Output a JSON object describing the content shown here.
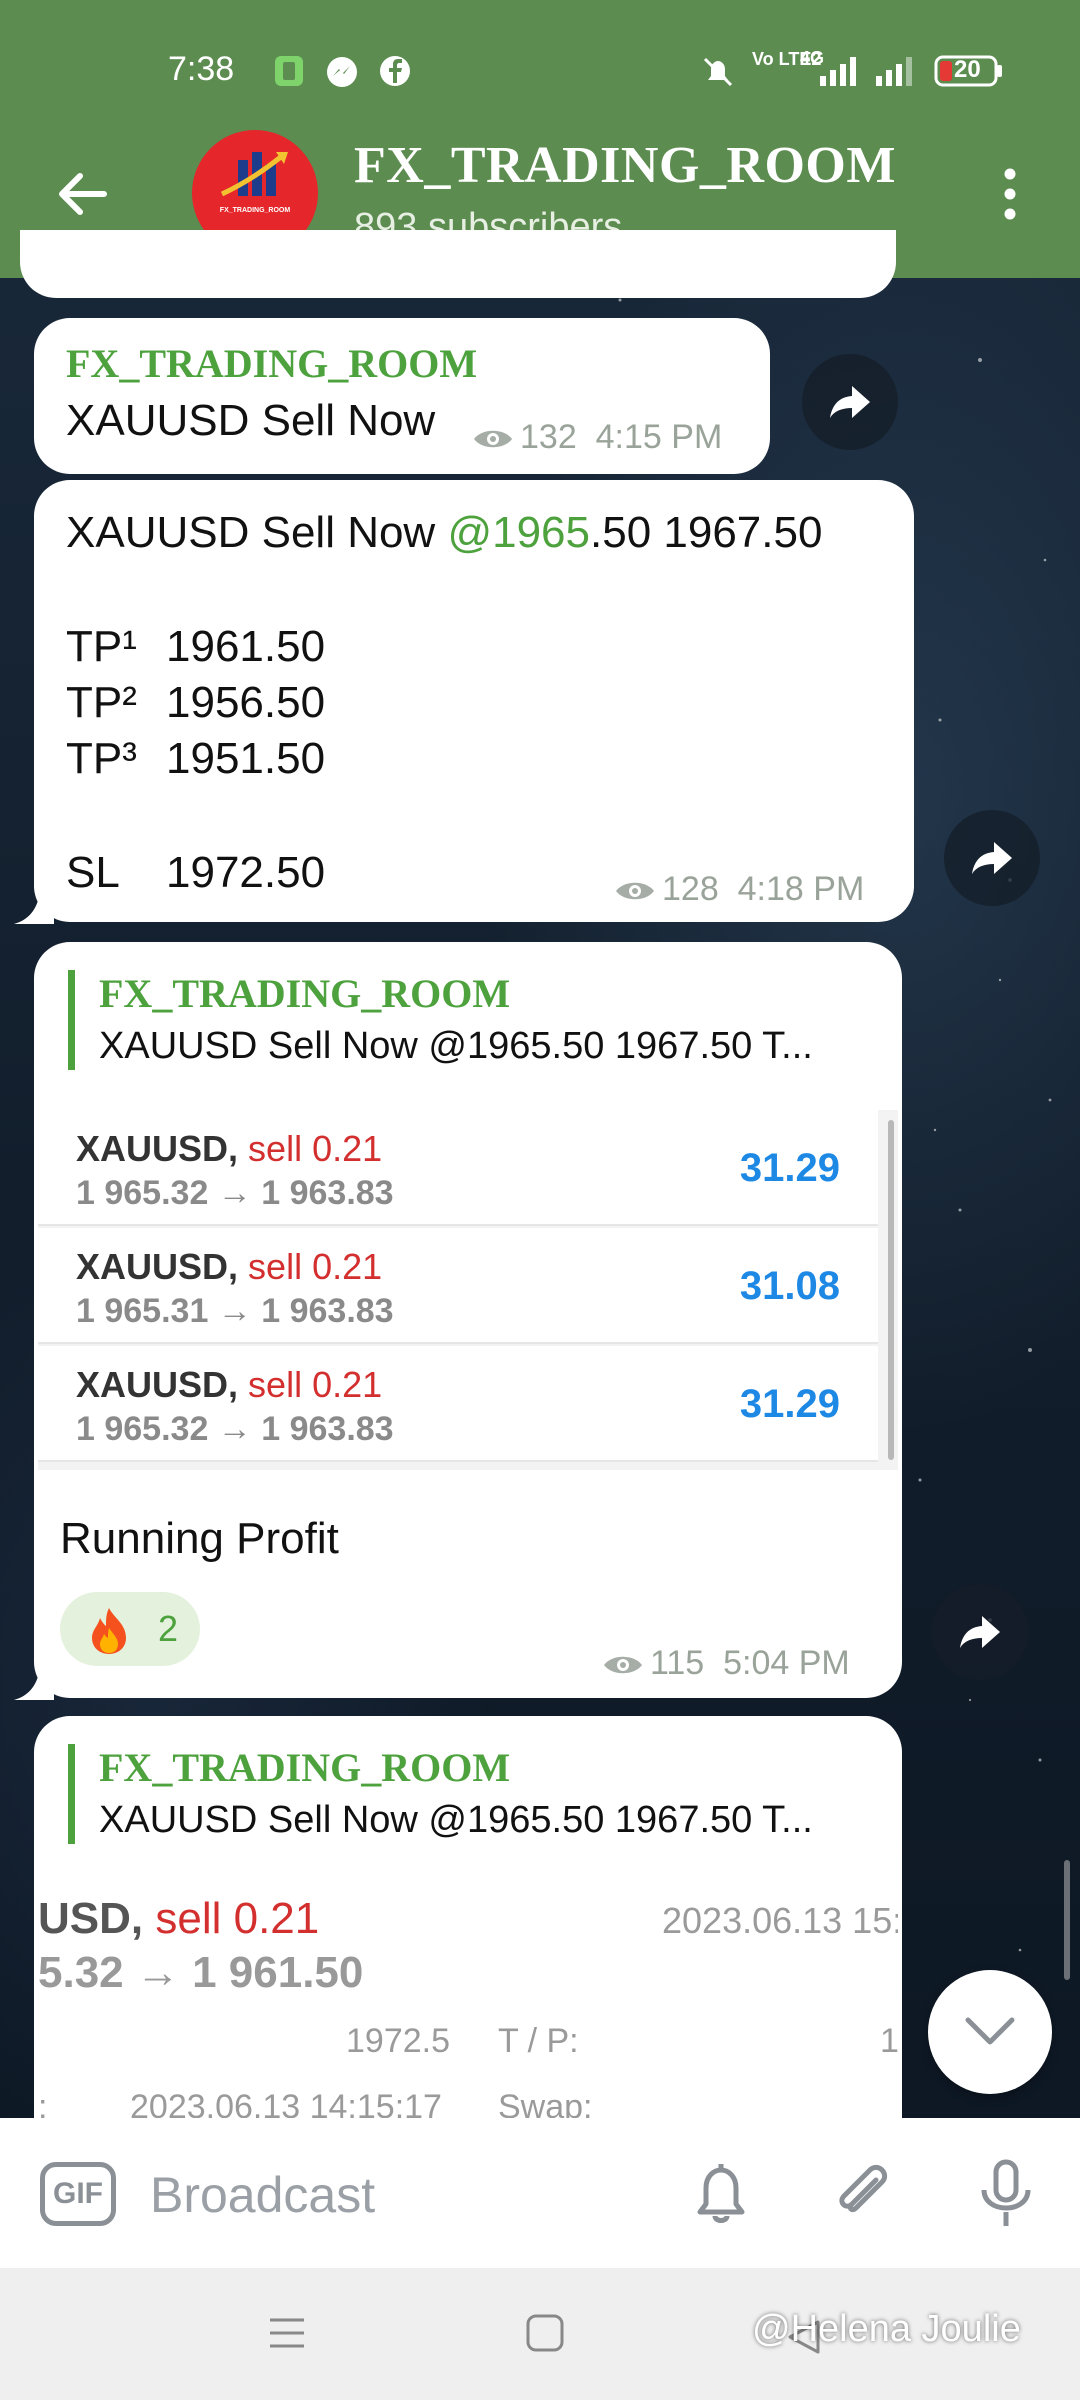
{
  "status_bar": {
    "time": "7:38",
    "battery": "20",
    "network": "4G",
    "volte": "Vo LTE2"
  },
  "header": {
    "title": "FX_TRADING_ROOM",
    "subtitle": "893 subscribers",
    "avatar_text": "FX_TRADING_ROOM",
    "colors": {
      "bar": "#5c8c50",
      "avatar": "#e5262a"
    }
  },
  "messages": [
    {
      "sender": "FX_TRADING_ROOM",
      "text": "XAUUSD Sell Now",
      "views": "132",
      "time": "4:15 PM"
    },
    {
      "line1_prefix": "XAUUSD Sell Now ",
      "line1_link": "@1965",
      "line1_suffix": ".50 1967.50",
      "tp1_label": "TP¹",
      "tp1_value": "1961.50",
      "tp2_label": "TP²",
      "tp2_value": "1956.50",
      "tp3_label": "TP³",
      "tp3_value": "1951.50",
      "sl_label": "SL",
      "sl_value": "1972.50",
      "views": "128",
      "time": "4:18 PM"
    },
    {
      "quote_sender": "FX_TRADING_ROOM",
      "quote_text": "XAUUSD Sell Now @1965.50 1967.50  T...",
      "trades": [
        {
          "symbol": "XAUUSD,",
          "side": "sell 0.21",
          "price": "1 965.32 → 1 963.83",
          "profit": "31.29"
        },
        {
          "symbol": "XAUUSD,",
          "side": "sell 0.21",
          "price": "1 965.31 → 1 963.83",
          "profit": "31.08"
        },
        {
          "symbol": "XAUUSD,",
          "side": "sell 0.21",
          "price": "1 965.32 → 1 963.83",
          "profit": "31.29"
        }
      ],
      "caption": "Running Profit",
      "reaction_count": "2",
      "views": "115",
      "time": "5:04 PM"
    },
    {
      "quote_sender": "FX_TRADING_ROOM",
      "quote_text": "XAUUSD Sell Now @1965.50 1967.50  T...",
      "detail_symbol": "USD,",
      "detail_side": "sell 0.21",
      "detail_date": "2023.06.13 15:",
      "detail_price": "5.32 → 1 961.50",
      "detail_sl": "1972.5",
      "detail_tp_label": "T / P:",
      "detail_tp_value": "1",
      "detail_open_label": ":",
      "detail_open_time": "2023.06.13 14:15:17",
      "detail_swap_label": "Swap:"
    }
  ],
  "composer": {
    "gif_label": "GIF",
    "placeholder": "Broadcast"
  },
  "watermark": "@Helena Joulie"
}
